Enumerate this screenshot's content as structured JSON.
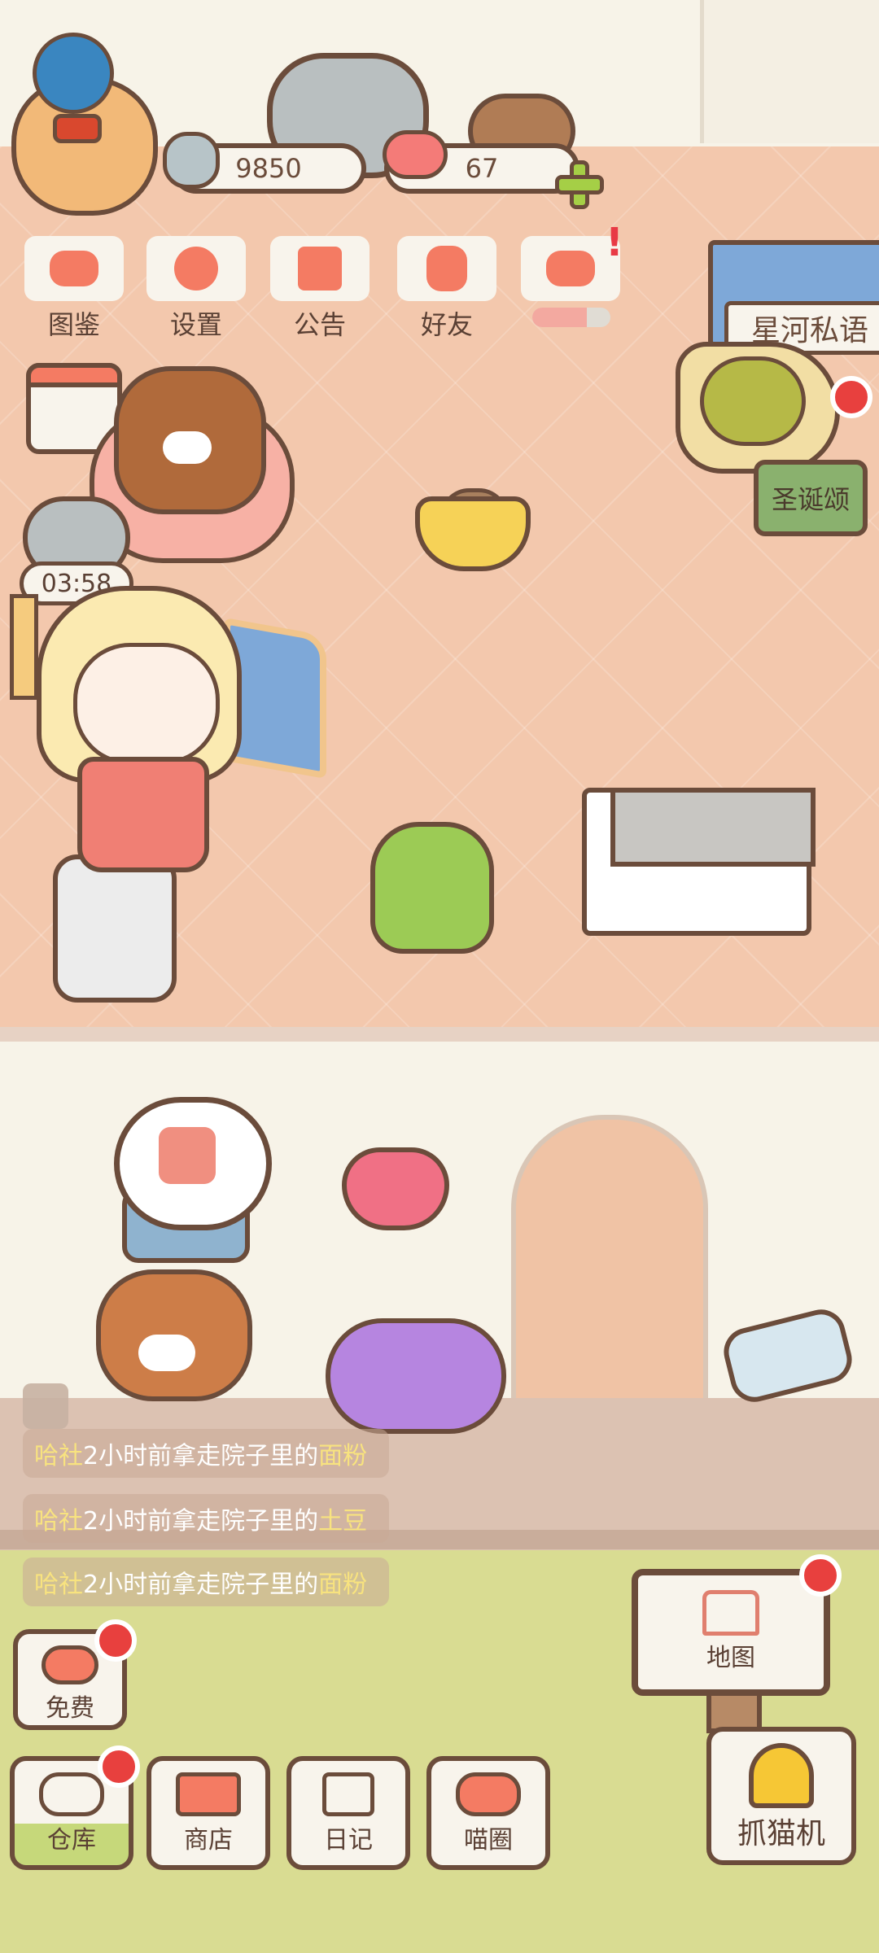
{
  "currency": {
    "coins": "9850",
    "hearts": "67"
  },
  "menu": {
    "tujian": "图鉴",
    "shezhi": "设置",
    "gonggao": "公告",
    "haoyou": "好友",
    "extra_progress": 0.7
  },
  "banner": {
    "label": "星河私语"
  },
  "xmas": {
    "label": "圣诞颂"
  },
  "timer": "03:58",
  "feed": [
    {
      "name": "哈社",
      "text": "2小时前拿走院子里的",
      "item": "面粉"
    },
    {
      "name": "哈社",
      "text": "2小时前拿走院子里的",
      "item": "土豆"
    },
    {
      "name": "哈社",
      "text": "2小时前拿走院子里的",
      "item": "面粉"
    }
  ],
  "buttons": {
    "free": "免费",
    "warehouse": "仓库",
    "shop": "商店",
    "diary": "日记",
    "meow": "喵圈",
    "map": "地图",
    "claw": "抓猫机"
  },
  "colors": {
    "accent_red": "#e8403e",
    "outline": "#6b4c3b",
    "floor": "#f3c8ad",
    "grass": "#d9dc92"
  }
}
